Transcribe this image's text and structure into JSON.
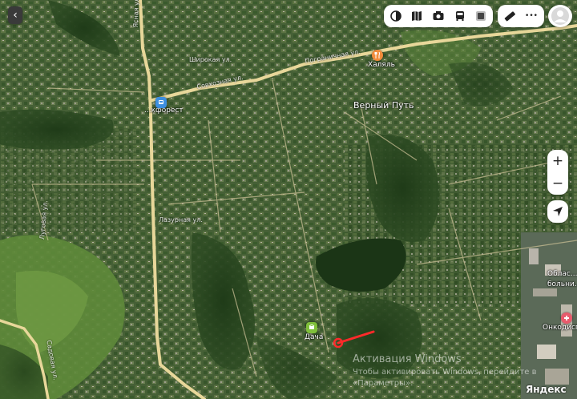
{
  "map": {
    "places": {
      "verny_put": "Верный Путь",
      "khalyal": "Халяль",
      "stop_top_left": "...кфорест",
      "dacha": "Дача",
      "oblastnaya": "Облас...",
      "bolnitsa": "больни...",
      "onkodispanser": "Онкодиспа..."
    },
    "streets": {
      "s1": "Широкая ул.",
      "s2": "Пограничная ул.",
      "s3": "Совхозная ул.",
      "s4": "Лазурная ул.",
      "s5": "Ясная ул.",
      "s6": "Луговая ул.",
      "s7": "Садовая ул."
    },
    "icons": {
      "stop": "bus-stop-icon",
      "food": "food-icon",
      "park": "park-icon",
      "hospital": "hospital-icon",
      "marker": "location-marker-icon"
    },
    "colors": {
      "road": "#e8d79a",
      "food_pin": "#f28c3c",
      "stop_pin": "#3d8fe0",
      "park_pin": "#7fbf3a",
      "hospital_pin": "#e85a6c",
      "marker": "#ff2a2a"
    }
  },
  "toolbar": {
    "layers_icon": "layers-icon",
    "panorama_icon": "panorama-icon",
    "camera_icon": "camera-icon",
    "transit_icon": "bus-icon",
    "traffic_icon": "traffic-icon",
    "ruler_icon": "ruler-icon",
    "more_label": "•••",
    "user_icon": "user-avatar-icon"
  },
  "controls": {
    "back_label": "‹",
    "zoom_in": "+",
    "zoom_out": "−",
    "geolocation_icon": "geolocation-icon"
  },
  "watermark": {
    "line1": "Активация Windows",
    "line2": "Чтобы активировать Windows, перейдите в",
    "line3": "«Параметры»."
  },
  "brand": "Яндекс"
}
